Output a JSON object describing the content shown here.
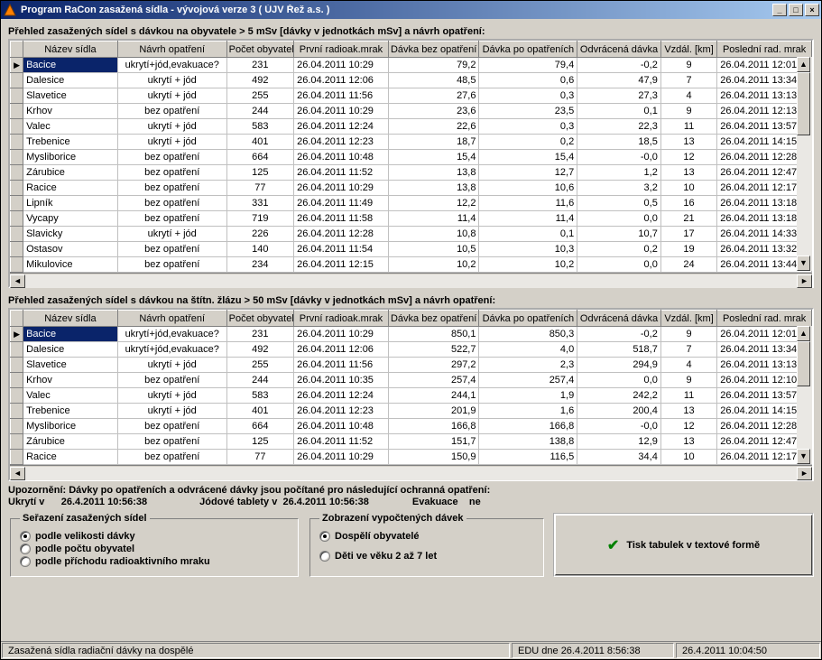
{
  "window": {
    "title": "Program RaCon   zasažená sídla - vývojová verze 3  ( ÚJV Řež a.s. )"
  },
  "table1_title": "Přehled zasažených sídel s dávkou na obyvatele > 5 mSv [dávky v jednotkách mSv] a návrh opatření:",
  "table2_title": "Přehled zasažených sídel s dávkou na štítn. žlázu > 50 mSv [dávky v jednotkách mSv] a návrh opatření:",
  "cols": {
    "c0": "Název sídla",
    "c1": "Návrh opatření",
    "c2": "Počet obyvatel",
    "c3": "První radioak.mrak",
    "c4": "Dávka bez opatření",
    "c5": "Dávka po opatřeních",
    "c6": "Odvrácená dávka",
    "c7": "Vzdál. [km]",
    "c8": "Poslední rad. mrak"
  },
  "t1": [
    {
      "name": "Bacice",
      "meas": "ukrytí+jód,evakuace?",
      "pop": "231",
      "first": "26.04.2011 10:29",
      "d0": "79,2",
      "d1": "79,4",
      "d2": "-0,2",
      "dist": "9",
      "last": "26.04.2011 12:01"
    },
    {
      "name": "Dalesice",
      "meas": "ukrytí + jód",
      "pop": "492",
      "first": "26.04.2011 12:06",
      "d0": "48,5",
      "d1": "0,6",
      "d2": "47,9",
      "dist": "7",
      "last": "26.04.2011 13:34"
    },
    {
      "name": "Slavetice",
      "meas": "ukrytí + jód",
      "pop": "255",
      "first": "26.04.2011 11:56",
      "d0": "27,6",
      "d1": "0,3",
      "d2": "27,3",
      "dist": "4",
      "last": "26.04.2011 13:13"
    },
    {
      "name": "Krhov",
      "meas": "bez opatření",
      "pop": "244",
      "first": "26.04.2011 10:29",
      "d0": "23,6",
      "d1": "23,5",
      "d2": "0,1",
      "dist": "9",
      "last": "26.04.2011 12:13"
    },
    {
      "name": "Valec",
      "meas": "ukrytí + jód",
      "pop": "583",
      "first": "26.04.2011 12:24",
      "d0": "22,6",
      "d1": "0,3",
      "d2": "22,3",
      "dist": "11",
      "last": "26.04.2011 13:57"
    },
    {
      "name": "Trebenice",
      "meas": "ukrytí + jód",
      "pop": "401",
      "first": "26.04.2011 12:23",
      "d0": "18,7",
      "d1": "0,2",
      "d2": "18,5",
      "dist": "13",
      "last": "26.04.2011 14:15"
    },
    {
      "name": "Mysliborice",
      "meas": "bez opatření",
      "pop": "664",
      "first": "26.04.2011 10:48",
      "d0": "15,4",
      "d1": "15,4",
      "d2": "-0,0",
      "dist": "12",
      "last": "26.04.2011 12:28"
    },
    {
      "name": "Zárubice",
      "meas": "bez opatření",
      "pop": "125",
      "first": "26.04.2011 11:52",
      "d0": "13,8",
      "d1": "12,7",
      "d2": "1,2",
      "dist": "13",
      "last": "26.04.2011 12:47"
    },
    {
      "name": "Racice",
      "meas": "bez opatření",
      "pop": "77",
      "first": "26.04.2011 10:29",
      "d0": "13,8",
      "d1": "10,6",
      "d2": "3,2",
      "dist": "10",
      "last": "26.04.2011 12:17"
    },
    {
      "name": "Lipník",
      "meas": "bez opatření",
      "pop": "331",
      "first": "26.04.2011 11:49",
      "d0": "12,2",
      "d1": "11,6",
      "d2": "0,5",
      "dist": "16",
      "last": "26.04.2011 13:18"
    },
    {
      "name": "Vycapy",
      "meas": "bez opatření",
      "pop": "719",
      "first": "26.04.2011 11:58",
      "d0": "11,4",
      "d1": "11,4",
      "d2": "0,0",
      "dist": "21",
      "last": "26.04.2011 13:18"
    },
    {
      "name": "Slavicky",
      "meas": "ukrytí + jód",
      "pop": "226",
      "first": "26.04.2011 12:28",
      "d0": "10,8",
      "d1": "0,1",
      "d2": "10,7",
      "dist": "17",
      "last": "26.04.2011 14:33"
    },
    {
      "name": "Ostasov",
      "meas": "bez opatření",
      "pop": "140",
      "first": "26.04.2011 11:54",
      "d0": "10,5",
      "d1": "10,3",
      "d2": "0,2",
      "dist": "19",
      "last": "26.04.2011 13:32"
    },
    {
      "name": "Mikulovice",
      "meas": "bez opatření",
      "pop": "234",
      "first": "26.04.2011 12:15",
      "d0": "10,2",
      "d1": "10,2",
      "d2": "0,0",
      "dist": "24",
      "last": "26.04.2011 13:44"
    }
  ],
  "t2": [
    {
      "name": "Bacice",
      "meas": "ukrytí+jód,evakuace?",
      "pop": "231",
      "first": "26.04.2011 10:29",
      "d0": "850,1",
      "d1": "850,3",
      "d2": "-0,2",
      "dist": "9",
      "last": "26.04.2011 12:01"
    },
    {
      "name": "Dalesice",
      "meas": "ukrytí+jód,evakuace?",
      "pop": "492",
      "first": "26.04.2011 12:06",
      "d0": "522,7",
      "d1": "4,0",
      "d2": "518,7",
      "dist": "7",
      "last": "26.04.2011 13:34"
    },
    {
      "name": "Slavetice",
      "meas": "ukrytí + jód",
      "pop": "255",
      "first": "26.04.2011 11:56",
      "d0": "297,2",
      "d1": "2,3",
      "d2": "294,9",
      "dist": "4",
      "last": "26.04.2011 13:13"
    },
    {
      "name": "Krhov",
      "meas": "bez opatření",
      "pop": "244",
      "first": "26.04.2011 10:35",
      "d0": "257,4",
      "d1": "257,4",
      "d2": "0,0",
      "dist": "9",
      "last": "26.04.2011 12:10"
    },
    {
      "name": "Valec",
      "meas": "ukrytí + jód",
      "pop": "583",
      "first": "26.04.2011 12:24",
      "d0": "244,1",
      "d1": "1,9",
      "d2": "242,2",
      "dist": "11",
      "last": "26.04.2011 13:57"
    },
    {
      "name": "Trebenice",
      "meas": "ukrytí + jód",
      "pop": "401",
      "first": "26.04.2011 12:23",
      "d0": "201,9",
      "d1": "1,6",
      "d2": "200,4",
      "dist": "13",
      "last": "26.04.2011 14:15"
    },
    {
      "name": "Mysliborice",
      "meas": "bez opatření",
      "pop": "664",
      "first": "26.04.2011 10:48",
      "d0": "166,8",
      "d1": "166,8",
      "d2": "-0,0",
      "dist": "12",
      "last": "26.04.2011 12:28"
    },
    {
      "name": "Zárubice",
      "meas": "bez opatření",
      "pop": "125",
      "first": "26.04.2011 11:52",
      "d0": "151,7",
      "d1": "138,8",
      "d2": "12,9",
      "dist": "13",
      "last": "26.04.2011 12:47"
    },
    {
      "name": "Racice",
      "meas": "bez opatření",
      "pop": "77",
      "first": "26.04.2011 10:29",
      "d0": "150,9",
      "d1": "116,5",
      "d2": "34,4",
      "dist": "10",
      "last": "26.04.2011 12:17"
    }
  ],
  "notice": {
    "line": "Upozornění: Dávky po opatřeních a odvrácené dávky jsou počítané pro následující ochranná opatření:",
    "ukryti_lbl": "Ukrytí v",
    "ukryti_val": "26.4.2011  10:56:38",
    "jod_lbl": "Jódové tablety v",
    "jod_val": "26.4.2011  10:56:38",
    "evak_lbl": "Evakuace",
    "evak_val": "ne"
  },
  "sort_group": {
    "legend": "Seřazení zasažených sídel",
    "opt1": "podle velikosti dávky",
    "opt2": "podle počtu obyvatel",
    "opt3": "podle příchodu radioaktivního mraku"
  },
  "dose_group": {
    "legend": "Zobrazení vypočtených dávek",
    "opt1": "Dospělí obyvatelé",
    "opt2": "Děti ve věku 2 až 7 let"
  },
  "print_btn": "Tisk tabulek v textové formě",
  "status": {
    "p1": "Zasažená sídla radiační dávky na dospělé",
    "p2": "EDU dne 26.4.2011  8:56:38",
    "p3": "26.4.2011  10:04:50"
  }
}
